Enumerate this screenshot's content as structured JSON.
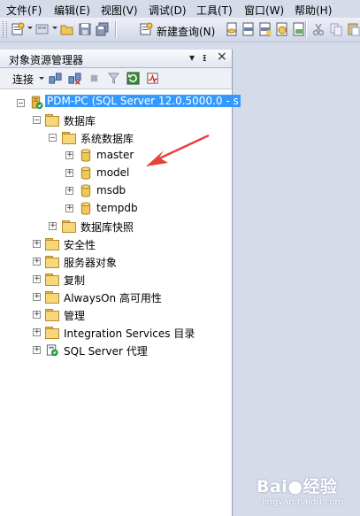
{
  "menubar": {
    "items": [
      "文件(F)",
      "编辑(E)",
      "视图(V)",
      "调试(D)",
      "工具(T)",
      "窗口(W)",
      "帮助(H)"
    ]
  },
  "toolbar": {
    "new_query_label": "新建查询(N)"
  },
  "explorer": {
    "title": "对象资源管理器",
    "pin_glyph": "▾",
    "autohide_glyph": "ᵻ",
    "close_glyph": "×",
    "connect_label": "连接",
    "server_node": "PDM-PC (SQL Server 12.0.5000.0 - s",
    "databases_label": "数据库",
    "system_databases_label": "系统数据库",
    "system_dbs": [
      "master",
      "model",
      "msdb",
      "tempdb"
    ],
    "snapshots_label": "数据库快照",
    "top_nodes": [
      "安全性",
      "服务器对象",
      "复制",
      "AlwaysOn 高可用性",
      "管理",
      "Integration Services 目录",
      "SQL Server 代理"
    ]
  },
  "watermark": {
    "brand": "Bai",
    "brand2": "经验",
    "url": "jingyan.baidu.com"
  },
  "colors": {
    "selection": "#3399ff",
    "arrow": "#e8413a"
  }
}
